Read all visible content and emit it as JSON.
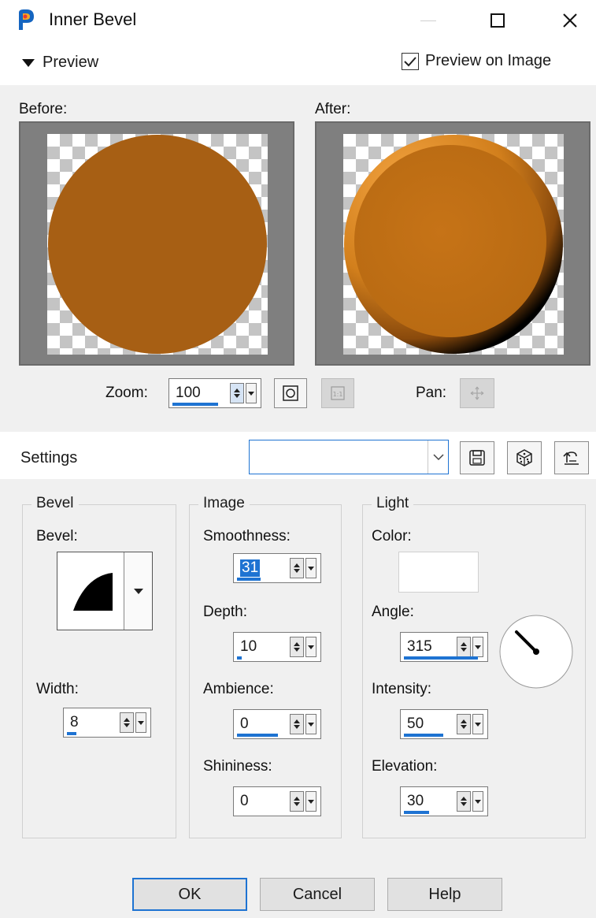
{
  "window": {
    "title": "Inner Bevel"
  },
  "preview": {
    "toggle_label": "Preview",
    "preview_on_image_label": "Preview on Image",
    "preview_on_image_checked": true,
    "before_label": "Before:",
    "after_label": "After:",
    "shape_color": "#a75f14",
    "zoom_label": "Zoom:",
    "zoom_value": "100",
    "pan_label": "Pan:"
  },
  "settings": {
    "label": "Settings",
    "preset_value": ""
  },
  "bevel_group": {
    "title": "Bevel",
    "bevel_label": "Bevel:",
    "width_label": "Width:",
    "width_value": "8"
  },
  "image_group": {
    "title": "Image",
    "smoothness_label": "Smoothness:",
    "smoothness_value": "31",
    "depth_label": "Depth:",
    "depth_value": "10",
    "ambience_label": "Ambience:",
    "ambience_value": "0",
    "shininess_label": "Shininess:",
    "shininess_value": "0"
  },
  "light_group": {
    "title": "Light",
    "color_label": "Color:",
    "color_value": "#ffffff",
    "angle_label": "Angle:",
    "angle_value": "315",
    "intensity_label": "Intensity:",
    "intensity_value": "50",
    "elevation_label": "Elevation:",
    "elevation_value": "30"
  },
  "buttons": {
    "ok": "OK",
    "cancel": "Cancel",
    "help": "Help"
  },
  "colors": {
    "accent": "#1e73d2",
    "panel": "#f0f0f0"
  }
}
